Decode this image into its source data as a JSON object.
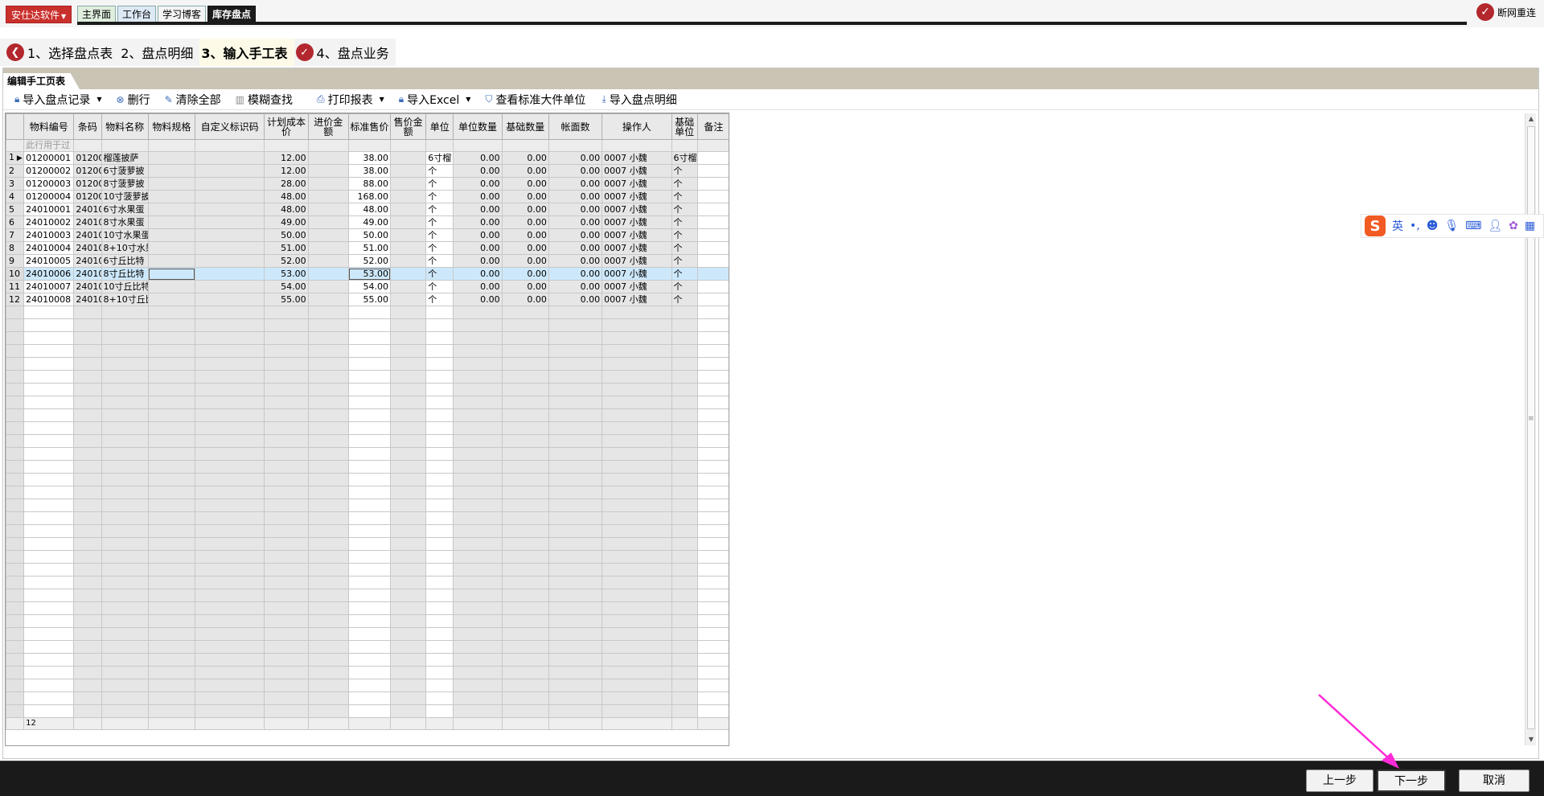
{
  "topbar": {
    "brand": "安仕达软件",
    "tabs": [
      "主界面",
      "工作台",
      "学习博客",
      "库存盘点"
    ],
    "disconnect": "断网重连"
  },
  "steps": [
    {
      "label": "1、选择盘点表",
      "icon": "back-arrow-icon"
    },
    {
      "label": "2、盘点明细",
      "icon": ""
    },
    {
      "label": "3、输入手工表",
      "icon": ""
    },
    {
      "label": "4、盘点业务",
      "icon": "check-icon"
    }
  ],
  "panel": {
    "title": "编辑手工页表"
  },
  "toolbar": {
    "import_records": "导入盘点记录",
    "delete_row": "删行",
    "clear_all": "清除全部",
    "fuzzy_search": "模糊查找",
    "print_report": "打印报表",
    "import_excel": "导入Excel",
    "view_units": "查看标准大件单位",
    "import_details": "导入盘点明细"
  },
  "grid": {
    "headers": [
      "物料编号",
      "条码",
      "物料名称",
      "物料规格",
      "自定义标识码",
      "计划成本价",
      "进价金额",
      "标准售价",
      "售价金额",
      "单位",
      "单位数量",
      "基础数量",
      "帐面数",
      "操作人",
      "基础单位",
      "备注"
    ],
    "filter_placeholder": "此行用于过",
    "rows": [
      {
        "n": "1",
        "code": "01200001",
        "bar": "01200",
        "name": "榴莲披萨",
        "cost": "12.00",
        "price": "38.00",
        "unit": "6寸榴",
        "qty": "0.00",
        "base": "0.00",
        "book": "0.00",
        "op": "0007 小魏",
        "bunit": "6寸榴"
      },
      {
        "n": "2",
        "code": "01200002",
        "bar": "01200",
        "name": "6寸菠萝披",
        "cost": "12.00",
        "price": "38.00",
        "unit": "个",
        "qty": "0.00",
        "base": "0.00",
        "book": "0.00",
        "op": "0007 小魏",
        "bunit": "个"
      },
      {
        "n": "3",
        "code": "01200003",
        "bar": "01200",
        "name": "8寸菠萝披",
        "cost": "28.00",
        "price": "88.00",
        "unit": "个",
        "qty": "0.00",
        "base": "0.00",
        "book": "0.00",
        "op": "0007 小魏",
        "bunit": "个"
      },
      {
        "n": "4",
        "code": "01200004",
        "bar": "01200",
        "name": "10寸菠萝披",
        "cost": "48.00",
        "price": "168.00",
        "unit": "个",
        "qty": "0.00",
        "base": "0.00",
        "book": "0.00",
        "op": "0007 小魏",
        "bunit": "个"
      },
      {
        "n": "5",
        "code": "24010001",
        "bar": "24010",
        "name": "6寸水果蛋",
        "cost": "48.00",
        "price": "48.00",
        "unit": "个",
        "qty": "0.00",
        "base": "0.00",
        "book": "0.00",
        "op": "0007 小魏",
        "bunit": "个"
      },
      {
        "n": "6",
        "code": "24010002",
        "bar": "24010",
        "name": "8寸水果蛋",
        "cost": "49.00",
        "price": "49.00",
        "unit": "个",
        "qty": "0.00",
        "base": "0.00",
        "book": "0.00",
        "op": "0007 小魏",
        "bunit": "个"
      },
      {
        "n": "7",
        "code": "24010003",
        "bar": "24010",
        "name": "10寸水果蛋",
        "cost": "50.00",
        "price": "50.00",
        "unit": "个",
        "qty": "0.00",
        "base": "0.00",
        "book": "0.00",
        "op": "0007 小魏",
        "bunit": "个"
      },
      {
        "n": "8",
        "code": "24010004",
        "bar": "24010",
        "name": "8+10寸水果",
        "cost": "51.00",
        "price": "51.00",
        "unit": "个",
        "qty": "0.00",
        "base": "0.00",
        "book": "0.00",
        "op": "0007 小魏",
        "bunit": "个"
      },
      {
        "n": "9",
        "code": "24010005",
        "bar": "24010",
        "name": "6寸丘比特",
        "cost": "52.00",
        "price": "52.00",
        "unit": "个",
        "qty": "0.00",
        "base": "0.00",
        "book": "0.00",
        "op": "0007 小魏",
        "bunit": "个"
      },
      {
        "n": "10",
        "code": "24010006",
        "bar": "24010",
        "name": "8寸丘比特",
        "cost": "53.00",
        "price": "53.00",
        "unit": "个",
        "qty": "0.00",
        "base": "0.00",
        "book": "0.00",
        "op": "0007 小魏",
        "bunit": "个"
      },
      {
        "n": "11",
        "code": "24010007",
        "bar": "24010",
        "name": "10寸丘比特",
        "cost": "54.00",
        "price": "54.00",
        "unit": "个",
        "qty": "0.00",
        "base": "0.00",
        "book": "0.00",
        "op": "0007 小魏",
        "bunit": "个"
      },
      {
        "n": "12",
        "code": "24010008",
        "bar": "24010",
        "name": "8+10寸丘比",
        "cost": "55.00",
        "price": "55.00",
        "unit": "个",
        "qty": "0.00",
        "base": "0.00",
        "book": "0.00",
        "op": "0007 小魏",
        "bunit": "个"
      }
    ],
    "selected_row": "10",
    "footer_count": "12"
  },
  "ime": {
    "mode": "英",
    "icons": [
      "punctuation-icon",
      "emoji-icon",
      "mic-icon",
      "keyboard-icon",
      "user-icon",
      "skin-icon",
      "grid-icon"
    ]
  },
  "bottom": {
    "prev": "上一步",
    "next": "下一步",
    "cancel": "取消"
  },
  "colors": {
    "accent_red": "#b3282e",
    "active_tab": "#1b1b1b",
    "selected_row": "#cde8fb",
    "annotation": "#ff2bd6"
  }
}
